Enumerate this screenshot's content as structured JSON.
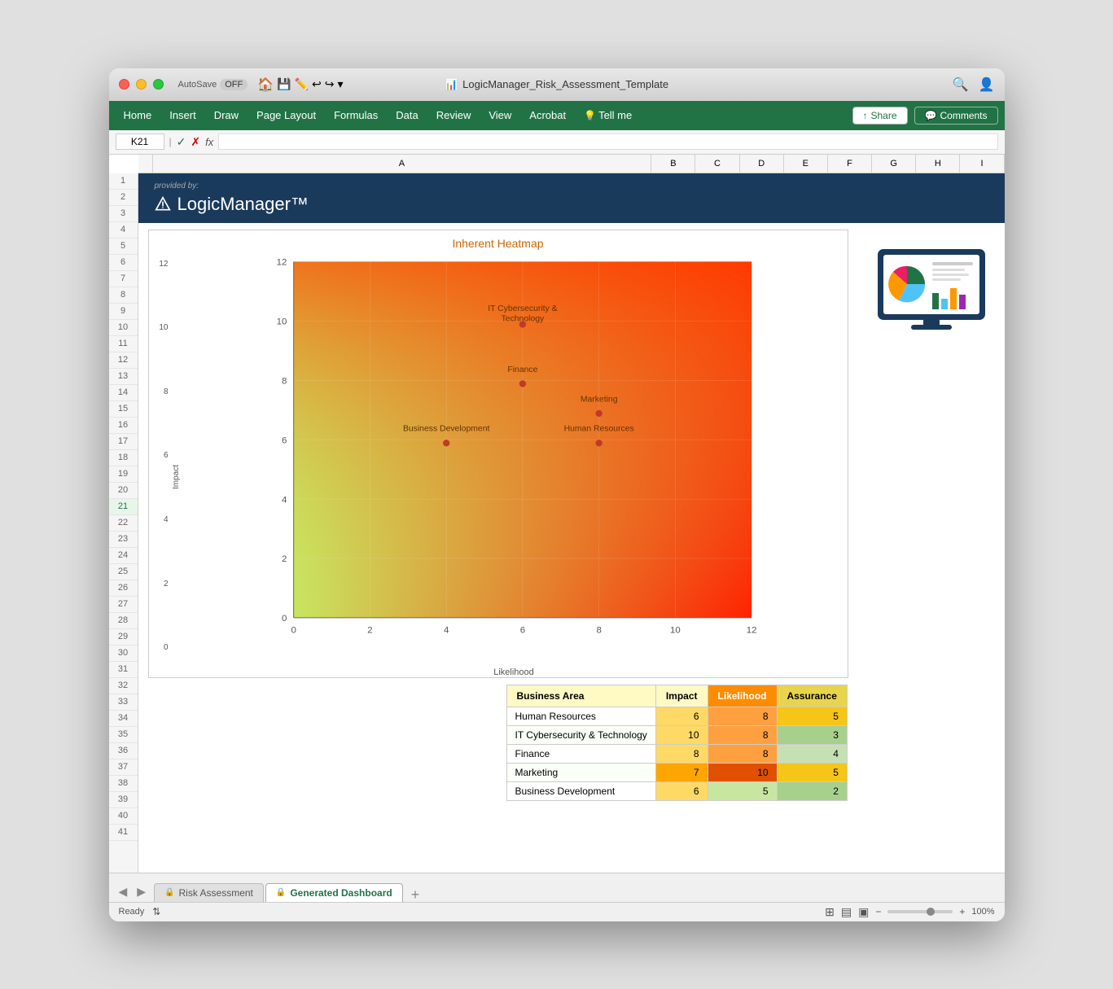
{
  "window": {
    "title": "LogicManager_Risk_Assessment_Template",
    "traffic_lights": [
      "close",
      "minimize",
      "fullscreen"
    ]
  },
  "toolbar": {
    "autosave_label": "AutoSave",
    "autosave_state": "OFF",
    "cell_ref": "K21",
    "fx_label": "fx"
  },
  "menu": {
    "items": [
      "Home",
      "Insert",
      "Draw",
      "Page Layout",
      "Formulas",
      "Data",
      "Review",
      "View",
      "Acrobat",
      "Tell me"
    ],
    "share_label": "Share",
    "comments_label": "Comments"
  },
  "logo": {
    "provided_by": "provided by:",
    "name": "LogicManager™"
  },
  "chart": {
    "title": "Inherent Heatmap",
    "x_axis_label": "Likelihood",
    "y_axis_label": "Impact",
    "y_ticks": [
      "0",
      "2",
      "4",
      "6",
      "8",
      "10",
      "12"
    ],
    "x_ticks": [
      "0",
      "2",
      "4",
      "6",
      "8",
      "10",
      "12"
    ],
    "data_points": [
      {
        "label": "Human Resources",
        "likelihood": 8,
        "impact": 6
      },
      {
        "label": "IT Cybersecurity &\nTechnology",
        "likelihood": 6,
        "impact": 10
      },
      {
        "label": "Finance",
        "likelihood": 6,
        "impact": 8
      },
      {
        "label": "Marketing",
        "likelihood": 8,
        "impact": 7
      },
      {
        "label": "Business Development",
        "likelihood": 4,
        "impact": 6
      }
    ]
  },
  "table": {
    "headers": [
      "Business Area",
      "Impact",
      "Likelihood",
      "Assurance"
    ],
    "rows": [
      {
        "area": "Human Resources",
        "impact": 6,
        "likelihood": 8,
        "assurance": 5
      },
      {
        "area": "IT Cybersecurity & Technology",
        "impact": 10,
        "likelihood": 8,
        "assurance": 3
      },
      {
        "area": "Finance",
        "impact": 8,
        "likelihood": 8,
        "assurance": 4
      },
      {
        "area": "Marketing",
        "impact": 7,
        "likelihood": 10,
        "assurance": 5
      },
      {
        "area": "Business Development",
        "impact": 6,
        "likelihood": 5,
        "assurance": 2
      }
    ],
    "impact_colors": {
      "6": "#ffd966",
      "10": "#ffd966",
      "8": "#ffd966",
      "7": "#ffa500",
      "5": "#ffd966"
    },
    "likelihood_colors": {
      "8": "#ffa040",
      "10": "#e05000",
      "5": "#c8e6a0"
    },
    "assurance_colors": {
      "5": "#f5c518",
      "3": "#a8d08d",
      "4": "#c6e0b4",
      "2": "#a8d08d"
    }
  },
  "sheets": {
    "tabs": [
      "Risk Assessment",
      "Generated Dashboard"
    ],
    "active": "Generated Dashboard",
    "add_label": "+"
  },
  "status_bar": {
    "ready_label": "Ready",
    "zoom_level": "100%"
  },
  "row_numbers": [
    "1",
    "2",
    "3",
    "4",
    "5",
    "6",
    "7",
    "8",
    "9",
    "10",
    "11",
    "12",
    "13",
    "14",
    "15",
    "16",
    "17",
    "18",
    "19",
    "20",
    "21",
    "22",
    "23",
    "24",
    "25",
    "26",
    "27",
    "28",
    "29",
    "30",
    "31",
    "32",
    "33",
    "34",
    "35",
    "36",
    "37",
    "38",
    "39",
    "40",
    "41"
  ],
  "col_headers": [
    "A",
    "B",
    "C",
    "D",
    "E",
    "F",
    "G",
    "H",
    "I"
  ]
}
